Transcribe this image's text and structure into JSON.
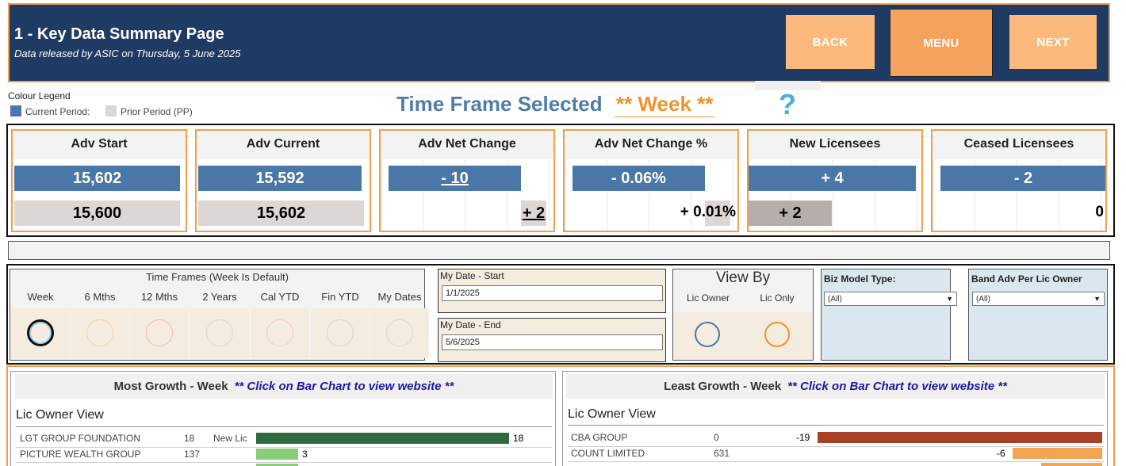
{
  "header": {
    "title": "1 - Key Data Summary Page",
    "subtitle": "Data released by ASIC on Thursday, 5 June 2025",
    "back_label": "BACK",
    "menu_label": "MENU",
    "next_label": "NEXT",
    "bg_color": "#1f3a63",
    "button_color": "#fbb97c"
  },
  "legend": {
    "title": "Colour Legend",
    "current_label": "Current Period:",
    "prior_label": "Prior Period (PP)",
    "current_color": "#4b77a8",
    "prior_color": "#dcd6d4"
  },
  "time_frame": {
    "label": "Time Frame Selected",
    "value": "** Week **",
    "help": "?"
  },
  "kpis": [
    {
      "title": "Adv Start",
      "current": "15,602",
      "prior": "15,600"
    },
    {
      "title": "Adv Current",
      "current": "15,592",
      "prior": "15,602"
    },
    {
      "title": "Adv Net Change",
      "current": "- 10",
      "prior": "+ 2"
    },
    {
      "title": "Adv Net Change %",
      "current": "- 0.06%",
      "prior": "+ 0.01%"
    },
    {
      "title": "New Licensees",
      "current": "+ 4",
      "prior": "+ 2"
    },
    {
      "title": "Ceased Licensees",
      "current": "- 2",
      "prior": "0"
    }
  ],
  "filters": {
    "time_frames_title": "Time Frames (Week Is Default)",
    "time_frame_options": [
      "Week",
      "6 Mths",
      "12 Mths",
      "2 Years",
      "Cal YTD",
      "Fin YTD",
      "My Dates"
    ],
    "selected_time_frame": "Week",
    "my_date_start_label": "My Date - Start",
    "my_date_start_value": "1/1/2025",
    "my_date_end_label": "My Date - End",
    "my_date_end_value": "5/6/2025",
    "view_by_title": "View By",
    "view_by_options": [
      "Lic Owner",
      "Lic Only"
    ],
    "biz_model_label": "Biz Model Type:",
    "biz_model_value": "(All)",
    "band_label": "Band Adv Per Lic Owner",
    "band_value": "(All)"
  },
  "most_growth": {
    "title": "Most Growth - Week",
    "hint": "** Click on Bar Chart to view website **",
    "view_label": "Lic Owner View",
    "rows": [
      {
        "name": "LGT GROUP FOUNDATION",
        "count": "18",
        "tag": "New Lic",
        "value": 18,
        "value_label": "18",
        "color": "#2e6b3f"
      },
      {
        "name": "PICTURE WEALTH GROUP",
        "count": "137",
        "tag": "",
        "value": 3,
        "value_label": "3",
        "color": "#86cf78"
      }
    ]
  },
  "least_growth": {
    "title": "Least Growth - Week",
    "hint": "** Click on Bar Chart to view website **",
    "view_label": "Lic Owner View",
    "rows": [
      {
        "name": "CBA GROUP",
        "count": "0",
        "value": -19,
        "value_label": "-19",
        "color": "#a84126"
      },
      {
        "name": "COUNT LIMITED",
        "count": "631",
        "value": -6,
        "value_label": "-6",
        "color": "#f3a553"
      }
    ]
  }
}
